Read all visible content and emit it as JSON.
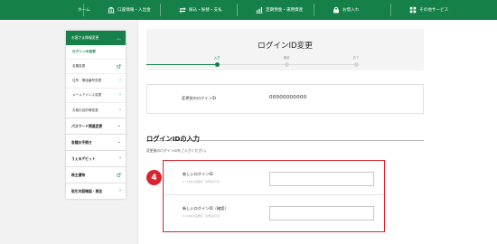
{
  "topnav": {
    "items": [
      {
        "label": "ホーム",
        "icon": "home-icon"
      },
      {
        "label": "口座情報・入出金",
        "icon": "bank-icon"
      },
      {
        "label": "振込・振替・支払",
        "icon": "transfer-icon"
      },
      {
        "label": "定期預金・運用資産",
        "icon": "savings-icon"
      },
      {
        "label": "お借入れ",
        "icon": "loan-icon"
      },
      {
        "label": "その他サービス",
        "icon": "grid-icon"
      }
    ],
    "bg_color": "#16804a"
  },
  "sidebar": {
    "section_title": "お客さま情報変更",
    "sub_items": [
      {
        "label": "ログインID変更",
        "active": true
      },
      {
        "label": "名義変更",
        "icon": "external-link-icon"
      },
      {
        "label": "住所・電話番号変更",
        "icon": "chevron-right-icon"
      },
      {
        "label": "メールアドレス変更",
        "icon": "chevron-right-icon"
      },
      {
        "label": "お取引目的等変更",
        "icon": "chevron-right-icon"
      }
    ],
    "main_items": [
      {
        "label": "パスワード関連変更",
        "icon": "chevron-down-icon"
      },
      {
        "label": "各種お手続き",
        "icon": "chevron-down-icon"
      },
      {
        "label": "うぇるデビット",
        "icon": "chevron-right-icon"
      },
      {
        "label": "株主優待",
        "icon": "external-link-icon"
      },
      {
        "label": "取引内容確認・照会",
        "icon": "chevron-right-icon"
      }
    ]
  },
  "page": {
    "title": "ログインID変更",
    "steps": [
      {
        "label": "入力",
        "active": true
      },
      {
        "label": "確認",
        "active": false
      },
      {
        "label": "完了",
        "active": false
      }
    ]
  },
  "current_id": {
    "label": "変更前のログインID",
    "value": "00000000000"
  },
  "section": {
    "heading": "ログインIDの入力",
    "instruction": "変更後のログインIDをご入力ください。"
  },
  "form": {
    "badge_number": "4",
    "new_id_label": "新しいログインID",
    "new_id_hint": "6〜16桁の英数字（記号は不可）",
    "new_id_value": "",
    "confirm_label": "新しいログインID（確認）",
    "confirm_hint": "6〜16桁の英数字（記号は不可）",
    "confirm_value": ""
  },
  "colors": {
    "accent": "#16804a",
    "highlight": "#d9232e"
  }
}
